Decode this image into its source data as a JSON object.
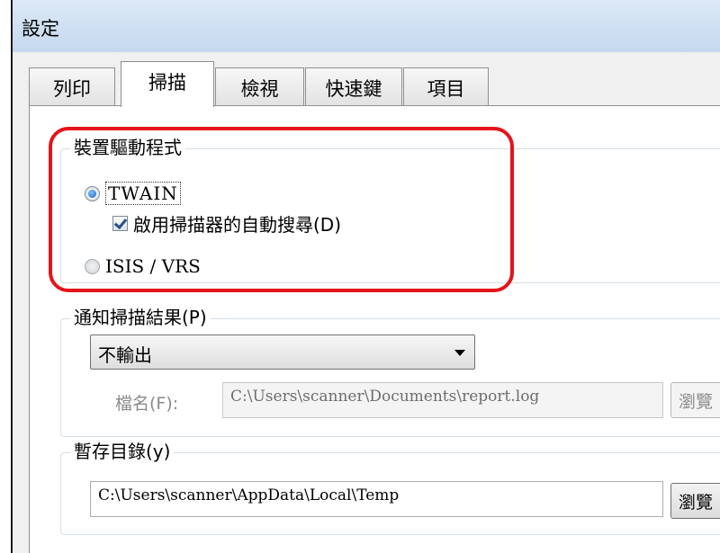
{
  "window": {
    "title": "設定"
  },
  "tabs": [
    {
      "label": "列印",
      "active": false
    },
    {
      "label": "掃描",
      "active": true
    },
    {
      "label": "檢視",
      "active": false
    },
    {
      "label": "快速鍵",
      "active": false
    },
    {
      "label": "項目",
      "active": false
    }
  ],
  "device_driver": {
    "legend": "裝置驅動程式",
    "twain_label": "TWAIN",
    "twain_selected": true,
    "auto_search_label": "啟用掃描器的自動搜尋(D)",
    "auto_search_checked": true,
    "isis_label": "ISIS / VRS",
    "isis_selected": false
  },
  "notify": {
    "legend": "通知掃描結果(P)",
    "output_selected": "不輸出",
    "filename_label": "檔名(F):",
    "filename_value": "C:\\Users\\scanner\\Documents\\report.log",
    "browse_label": "瀏覽"
  },
  "temp": {
    "legend": "暫存目錄(y)",
    "path_value": "C:\\Users\\scanner\\AppData\\Local\\Temp",
    "browse_label": "瀏覽"
  },
  "colors": {
    "highlight": "#e3141a",
    "titlebar": "#c5d8ee"
  }
}
